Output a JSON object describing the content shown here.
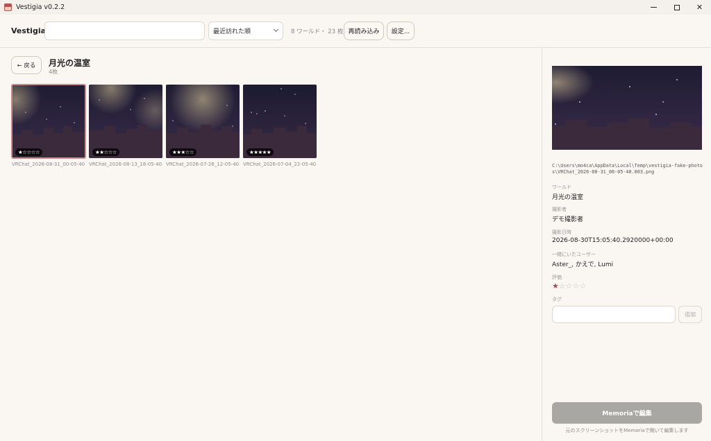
{
  "window": {
    "title": "Vestigia v0.2.2",
    "minimize_glyph": "",
    "close_glyph": "✕"
  },
  "toolbar": {
    "brand": "Vestigia",
    "search_value": "",
    "sort_label": "最近訪れた順",
    "counts": "8 ワールド・ 23 枚",
    "reload_label": "再読み込み",
    "settings_label": "設定..."
  },
  "world": {
    "back_label": "← 戻る",
    "title": "月光の温室",
    "count": "4枚"
  },
  "photos": [
    {
      "filename": "VRChat_2026-08-31_00-05-40...",
      "stars": "★☆☆☆☆",
      "selected": true
    },
    {
      "filename": "VRChat_2026-08-13_18-05-40...",
      "stars": "★★☆☆☆",
      "selected": false
    },
    {
      "filename": "VRChat_2026-07-26_12-05-40...",
      "stars": "★★★☆☆",
      "selected": false
    },
    {
      "filename": "VRChat_2026-07-04_22-05-40...",
      "stars": "★★★★★",
      "selected": false
    }
  ],
  "detail": {
    "path": "C:\\Users\\mo4ca\\AppData\\Local\\Temp\\vestigia-fake-photos\\VRChat_2026-08-31_00-05-40.003.png",
    "world_label": "ワールド",
    "world_value": "月光の温室",
    "photographer_label": "撮影者",
    "photographer_value": "デモ撮影者",
    "datetime_label": "撮影日時",
    "datetime_value": "2026-08-30T15:05:40.2920000+00:00",
    "users_label": "一緒にいたユーザー",
    "users_value": "Aster_, かえで, Lumi",
    "rating_label": "評価",
    "rating_on": "★",
    "rating_off": "☆☆☆☆",
    "rating": 1,
    "tag_label": "タグ",
    "tag_value": "",
    "add_label": "追加",
    "memoria_label": "Memoriaで編集",
    "memoria_note": "元のスクリーンショットをMemoriaで開いて編集します"
  },
  "colors": {
    "sky_top": "#1e1c33",
    "sky_bottom": "#3a2c4a",
    "buildings": "#3a2a3c",
    "glow": "#d9c79a",
    "selected_outline": "#c98a8a",
    "rating_on": "#a05050"
  }
}
